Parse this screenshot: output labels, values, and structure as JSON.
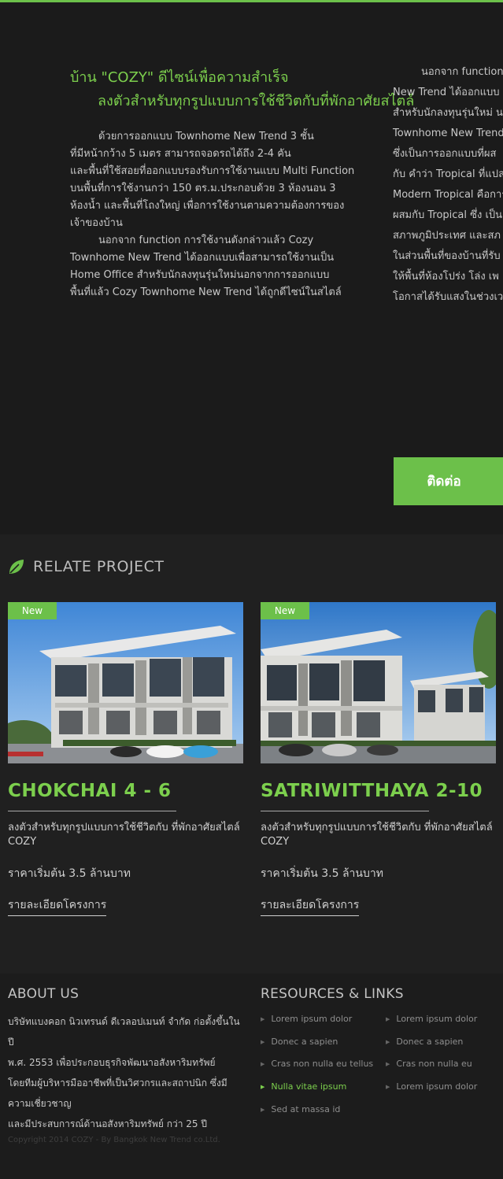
{
  "hero": {
    "title_line1": "บ้าน \"COZY\" ดีไซน์เพื่อความสำเร็จ",
    "title_line2": "ลงตัวสำหรับทุกรูปแบบการใช้ชีวิตกับที่พักอาศัยสไตล์",
    "col1_para1": [
      "ด้วยการออกแบบ Townhome New Trend 3 ชั้น",
      "ที่มีหน้ากว้าง 5 เมตร สามารถจอดรถได้ถึง 2-4 คัน",
      "และพื้นที่ใช้สอยที่ออกแบบรองรับการใช้งานแบบ Multi Function",
      "บนพื้นที่การใช้งานกว่า 150 ตร.ม.ประกอบด้วย 3 ห้องนอน 3",
      "ห้องน้ำ และพื้นที่โถงใหญ่ เพื่อการใช้งานตามความต้องการของ",
      "เจ้าของบ้าน"
    ],
    "col1_para2": [
      "นอกจาก function การใช้งานดังกล่าวแล้ว Cozy",
      "Townhome New Trend ได้ออกแบบเพื่อสามารถใช้งานเป็น",
      "Home Office สำหรับนักลงทุนรุ่นใหม่นอกจากการออกแบบ",
      "พื้นที่แล้ว Cozy Townhome New Trend ได้ถูกดีไซน์ในสไตล์"
    ],
    "col2_lines": [
      "นอกจาก function",
      "New Trend ได้ออกแบบ",
      "สำหรับนักลงทุนรุ่นใหม่ น",
      "Townhome New Trend",
      "ซึ่งเป็นการออกแบบที่ผส",
      "กับ คำว่า Tropical ที่แปล",
      "Modern Tropical คือการ",
      "ผสมกับ Tropical ซึ่ง เป็น",
      "สภาพภูมิประเทศ และสภ",
      "ในส่วนพื้นที่ของบ้านที่รับ",
      "ให้พื้นที่ห้องโปร่ง โล่ง เพ",
      "โอกาสได้รับแสงในช่วงเว"
    ],
    "contact_label": "ติดต่อ"
  },
  "relate": {
    "title": "RELATE PROJECT",
    "projects": [
      {
        "badge": "New",
        "name": "CHOKCHAI 4 - 6",
        "desc": "ลงตัวสำหรับทุกรูปแบบการใช้ชีวิตกับ ที่พักอาศัยสไตล์ COZY",
        "price": "ราคาเริ่มต้น 3.5 ล้านบาท",
        "link": "รายละเอียดโครงการ"
      },
      {
        "badge": "New",
        "name": "SATRIWITTHAYA 2-10",
        "desc": "ลงตัวสำหรับทุกรูปแบบการใช้ชีวิตกับ ที่พักอาศัยสไตล์ COZY",
        "price": "ราคาเริ่มต้น 3.5 ล้านบาท",
        "link": "รายละเอียดโครงการ"
      }
    ]
  },
  "footer": {
    "about_title": "ABOUT US",
    "about_lines": [
      "บริษัทแบงคอก นิวเทรนด์ ดีเวลอปเมนท์ จำกัด ก่อตั้งขึ้นในปี",
      "พ.ศ. 2553 เพื่อประกอบธุรกิจพัฒนาอสังหาริมทรัพย์",
      "โดยทีมผู้บริหารมืออาชีพที่เป็นวิศวกรและสถาปนิก ซึ่งมีความเชี่ยวชาญ",
      "และมีประสบการณ์ด้านอสังหาริมทรัพย์ กว่า 25 ปี"
    ],
    "links_title": "RESOURCES & LINKS",
    "links_col1": [
      "Lorem ipsum dolor",
      "Donec a sapien",
      "Cras non nulla eu tellus",
      "Nulla vitae ipsum",
      "Sed at massa id"
    ],
    "links_col2": [
      "Lorem ipsum dolor",
      "Donec a sapien",
      "Cras non nulla eu",
      "Lorem ipsum dolor"
    ],
    "copyright": "Copyright 2014 COZY - By Bangkok New Trend co.Ltd."
  },
  "colors": {
    "accent": "#6cc04a",
    "background": "#1a1a1a",
    "footer_bg": "#1c1c1c"
  },
  "icons": {
    "relate_icon": "leaf-icon",
    "link_bullet": "triangle-right-icon"
  }
}
